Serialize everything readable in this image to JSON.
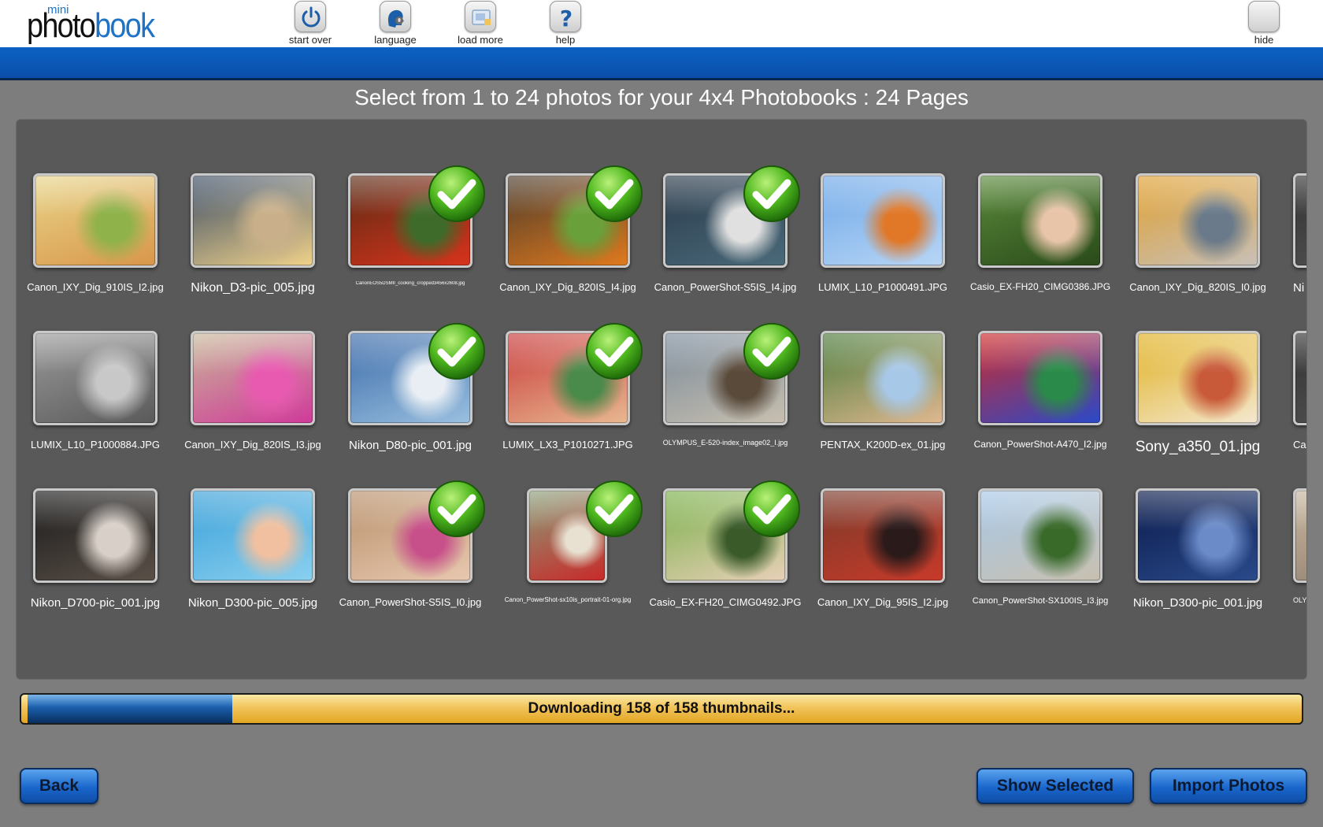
{
  "app": {
    "logo_mini": "mini",
    "logo_photo": "photo",
    "logo_book": "book"
  },
  "toolbar": {
    "start_over": "start over",
    "language": "language",
    "load_more": "load more",
    "help": "help",
    "hide": "hide"
  },
  "title": "Select from 1 to 24 photos for your 4x4 Photobooks : 24 Pages",
  "photos": [
    {
      "filename": "Canon_IXY_Dig_910IS_I2.jpg",
      "selected": false,
      "colors": [
        "#e8d58a",
        "#d9964a",
        "#8fb24a"
      ],
      "font_size": 13
    },
    {
      "filename": "Nikon_D3-pic_005.jpg",
      "selected": false,
      "colors": [
        "#3a4c66",
        "#f0d28a",
        "#c9b08a"
      ],
      "font_size": 16
    },
    {
      "filename": "CanonEOS5DSMII_cooking_cropped3456x2608.jpg",
      "selected": true,
      "colors": [
        "#5a2a14",
        "#d8331c",
        "#3f6b2a"
      ],
      "font_size": 6
    },
    {
      "filename": "Canon_IXY_Dig_820IS_I4.jpg",
      "selected": true,
      "colors": [
        "#4a3a2a",
        "#e07a1e",
        "#6aa03a"
      ],
      "font_size": 13
    },
    {
      "filename": "Canon_PowerShot-S5IS_I4.jpg",
      "selected": true,
      "colors": [
        "#2a3a4a",
        "#4a6a7a",
        "#e0e0e0"
      ],
      "font_size": 13
    },
    {
      "filename": "LUMIX_L10_P1000491.JPG",
      "selected": false,
      "colors": [
        "#6fa8e8",
        "#b8d6f5",
        "#e07828"
      ],
      "font_size": 13
    },
    {
      "filename": "Casio_EX-FH20_CIMG0386.JPG",
      "selected": false,
      "colors": [
        "#5a8a3a",
        "#2a4a1a",
        "#e8c4a8"
      ],
      "font_size": 12
    },
    {
      "filename": "Canon_IXY_Dig_820IS_I0.jpg",
      "selected": false,
      "colors": [
        "#e0a030",
        "#c8c0b8",
        "#6a7a8a"
      ],
      "font_size": 13
    },
    {
      "filename": "Ni",
      "selected": false,
      "colors": [
        "#333333",
        "#555555",
        "#777777"
      ],
      "font_size": 15
    },
    {
      "filename": "LUMIX_L10_P1000884.JPG",
      "selected": false,
      "colors": [
        "#9a9a9a",
        "#5a5a5a",
        "#c8c8c8"
      ],
      "font_size": 13
    },
    {
      "filename": "Canon_IXY_Dig_820IS_I3.jpg",
      "selected": false,
      "colors": [
        "#c8b898",
        "#d03a9a",
        "#e85ab0"
      ],
      "font_size": 13
    },
    {
      "filename": "Nikon_D80-pic_001.jpg",
      "selected": true,
      "colors": [
        "#3a6aa8",
        "#9ac0e0",
        "#e8eef4"
      ],
      "font_size": 15
    },
    {
      "filename": "LUMIX_LX3_P1010271.JPG",
      "selected": true,
      "colors": [
        "#c83a3a",
        "#e8b890",
        "#4a8a4a"
      ],
      "font_size": 13
    },
    {
      "filename": "OLYMPUS_E-520-index_image02_I.jpg",
      "selected": true,
      "colors": [
        "#7a8a9a",
        "#c8c0b0",
        "#5a4a3a"
      ],
      "font_size": 9
    },
    {
      "filename": "PENTAX_K200D-ex_01.jpg",
      "selected": false,
      "colors": [
        "#4a7a3a",
        "#e0b890",
        "#a8c8e8"
      ],
      "font_size": 13
    },
    {
      "filename": "Canon_PowerShot-A470_I2.jpg",
      "selected": false,
      "colors": [
        "#d02a2a",
        "#2a4ac8",
        "#2a8a4a"
      ],
      "font_size": 12
    },
    {
      "filename": "Sony_a350_01.jpg",
      "selected": false,
      "colors": [
        "#e0b020",
        "#f4e8d0",
        "#c85a3a"
      ],
      "font_size": 19
    },
    {
      "filename": "Ca",
      "selected": false,
      "colors": [
        "#333333",
        "#555555",
        "#777777"
      ],
      "font_size": 13
    },
    {
      "filename": "Nikon_D700-pic_001.jpg",
      "selected": false,
      "colors": [
        "#1a1a1a",
        "#5a5048",
        "#d8d0c8"
      ],
      "font_size": 15
    },
    {
      "filename": "Nikon_D300-pic_005.jpg",
      "selected": false,
      "colors": [
        "#3aa0d8",
        "#8ad0f0",
        "#f0c0a0"
      ],
      "font_size": 15
    },
    {
      "filename": "Canon_PowerShot-S5IS_I0.jpg",
      "selected": true,
      "colors": [
        "#b8906a",
        "#e8c8b0",
        "#c8508a"
      ],
      "font_size": 13
    },
    {
      "filename": "Canon_PowerShot-sx10is_portrait-01-org.jpg",
      "selected": true,
      "colors": [
        "#8aa07a",
        "#c82a2a",
        "#e8e0d0"
      ],
      "font_size": 8,
      "portrait": true
    },
    {
      "filename": "Casio_EX-FH20_CIMG0492.JPG",
      "selected": true,
      "colors": [
        "#7ab04a",
        "#e8d0b8",
        "#3a5a2a"
      ],
      "font_size": 13
    },
    {
      "filename": "Canon_IXY_Dig_95IS_I2.jpg",
      "selected": false,
      "colors": [
        "#7a3a2a",
        "#c83a2a",
        "#2a1a1a"
      ],
      "font_size": 13
    },
    {
      "filename": "Canon_PowerShot-SX100IS_I3.jpg",
      "selected": false,
      "colors": [
        "#a8c8e8",
        "#c8c0b0",
        "#3a6a2a"
      ],
      "font_size": 11
    },
    {
      "filename": "Nikon_D300-pic_001.jpg",
      "selected": false,
      "colors": [
        "#0a1a4a",
        "#2a4a8a",
        "#6a8ac8"
      ],
      "font_size": 15
    },
    {
      "filename": "OLY",
      "selected": false,
      "colors": [
        "#c8b8a0",
        "#8a7a6a",
        "#e8e0d0"
      ],
      "font_size": 9
    }
  ],
  "progress": {
    "text": "Downloading 158 of 158 thumbnails...",
    "fraction": 0.16
  },
  "buttons": {
    "back": "Back",
    "show_selected": "Show Selected",
    "import_photos": "Import Photos"
  }
}
